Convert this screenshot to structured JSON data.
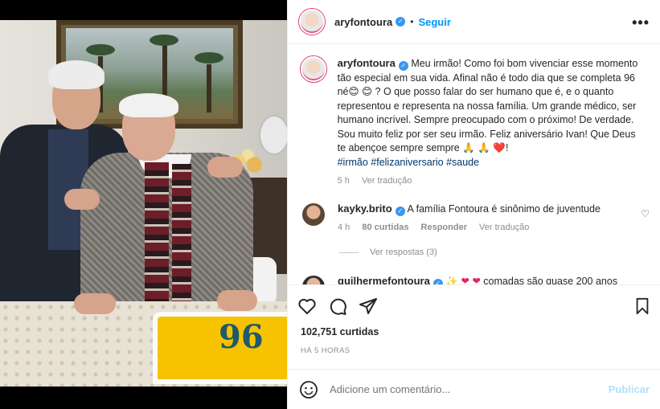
{
  "post": {
    "author": "aryfontoura",
    "follow_label": "Seguir",
    "dot": "•",
    "more_label": "•••",
    "caption_part1": "Meu irmão! Como foi bom vivenciar esse momento tão especial em sua vida. Afinal não é todo dia que se completa 96 né",
    "caption_emoji1": "😊",
    "caption_emoji2": "😊",
    "caption_part2": "? O que posso falar do ser humano que é, e o quanto representou e representa na nossa família. Um grande médico, ser humano incrível. Sempre preocupado com o próximo! De verdade. Sou muito feliz por ser seu irmão. Feliz aniversário Ivan! Que Deus te abençoe sempre sempre",
    "caption_emoji3": "🙏",
    "caption_emoji4": "🙏",
    "caption_emoji5": "❤️",
    "caption_end": "!",
    "hashtags": "#irmão #felizaniversario #saude",
    "caption_time": "5 h",
    "see_translation": "Ver tradução",
    "photo_number": "96"
  },
  "comments": [
    {
      "user": "kayky.brito",
      "text": "A família Fontoura é sinônimo de juventude",
      "time": "4 h",
      "likes": "80 curtidas",
      "reply": "Responder",
      "translate": "Ver tradução",
      "view_replies": "Ver respostas (3)"
    },
    {
      "user": "guilhermefontoura",
      "text": "comadas são quase 200 anos"
    }
  ],
  "actions": {
    "like_icon": "heart-icon",
    "comment_icon": "comment-icon",
    "share_icon": "share-icon",
    "save_icon": "bookmark-icon"
  },
  "stats": {
    "likes": "102,751 curtidas",
    "posted": "HÁ 5 HORAS"
  },
  "add_comment": {
    "placeholder": "Adicione um comentário...",
    "publish": "Publicar"
  },
  "colors": {
    "accent": "#0095f6",
    "verified": "#3897f0",
    "hashtag": "#00376b",
    "muted": "#8e8e8e"
  }
}
